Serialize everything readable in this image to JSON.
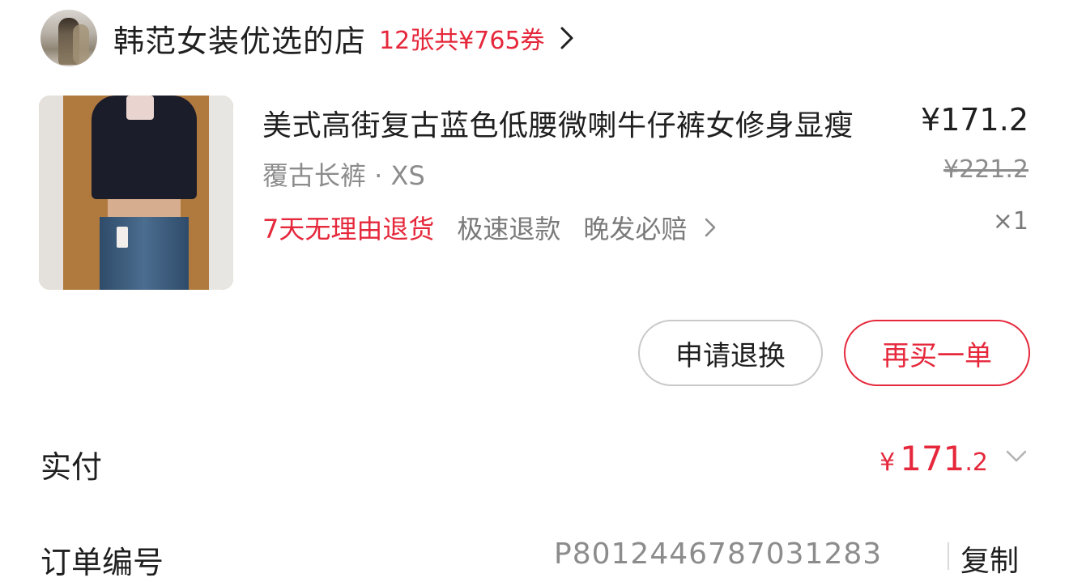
{
  "store": {
    "name": "韩范女装优选的店",
    "coupon_text": "12张共¥765券"
  },
  "product": {
    "title": "美式高街复古蓝色低腰微喇牛仔裤女修身显瘦",
    "price": "¥171.2",
    "sku": "覆古长裤 · XS",
    "original_price": "¥221.2",
    "quantity": "×1",
    "services": [
      "7天无理由退货",
      "极速退款",
      "晚发必赔"
    ]
  },
  "actions": {
    "return_label": "申请退换",
    "rebuy_label": "再买一单"
  },
  "payment": {
    "label": "实付",
    "currency": "¥",
    "integer": "171",
    "decimal": ".2"
  },
  "order": {
    "label": "订单编号",
    "number": "P8012446787031283",
    "copy_label": "复制"
  },
  "colors": {
    "accent": "#e5283b",
    "text": "#1f1f1f",
    "muted": "#8c8c8c"
  }
}
